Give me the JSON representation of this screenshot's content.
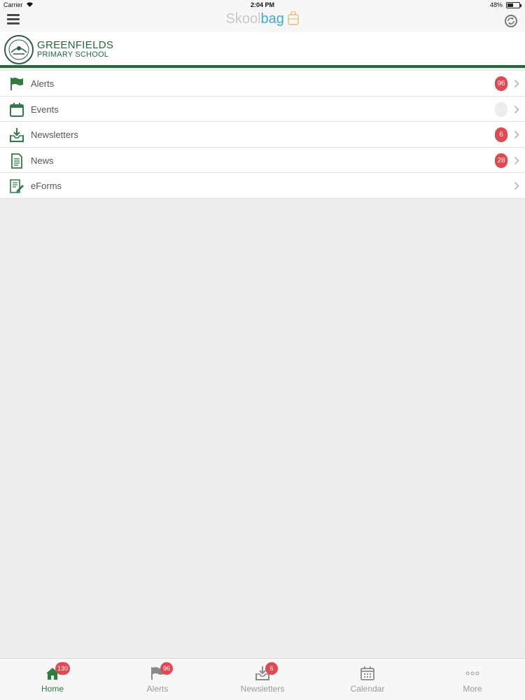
{
  "status_bar": {
    "carrier": "Carrier",
    "time": "2:04 PM",
    "battery": "48%"
  },
  "nav_bar": {
    "logo_part1": "Skool",
    "logo_part2": "bag"
  },
  "school": {
    "name_line1": "GREENFIELDS",
    "name_line2": "PRIMARY SCHOOL"
  },
  "colors": {
    "brand_green": "#1f6b3a",
    "badge_red": "#e34850",
    "logo_blue": "#3ea8d8"
  },
  "menu": {
    "items": [
      {
        "label": "Alerts",
        "icon": "flag-icon",
        "badge": "96"
      },
      {
        "label": "Events",
        "icon": "calendar-icon",
        "badge": ""
      },
      {
        "label": "Newsletters",
        "icon": "inbox-download-icon",
        "badge": "6"
      },
      {
        "label": "News",
        "icon": "document-icon",
        "badge": "28"
      },
      {
        "label": "eForms",
        "icon": "form-edit-icon"
      }
    ]
  },
  "tabs": [
    {
      "label": "Home",
      "icon": "home-icon",
      "badge": "130",
      "active": true
    },
    {
      "label": "Alerts",
      "icon": "flag-icon",
      "badge": "96"
    },
    {
      "label": "Newsletters",
      "icon": "inbox-download-icon",
      "badge": "6"
    },
    {
      "label": "Calendar",
      "icon": "calendar-icon"
    },
    {
      "label": "More",
      "icon": "more-dots-icon"
    }
  ]
}
